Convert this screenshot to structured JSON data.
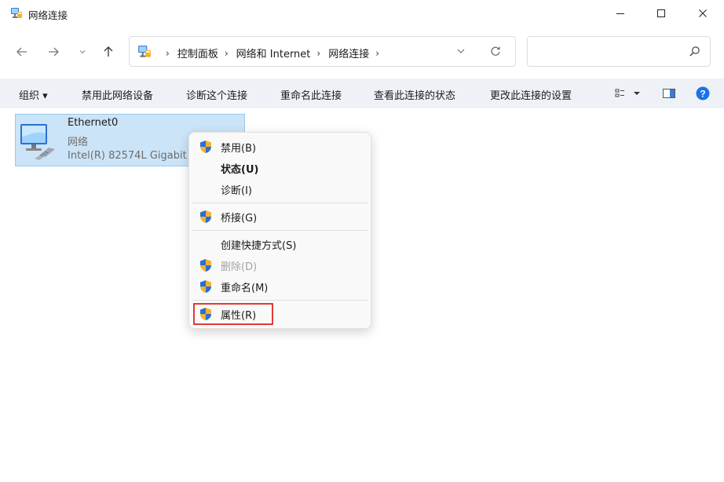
{
  "window": {
    "title": "网络连接",
    "minimize_label": "—",
    "maximize_label": "☐",
    "close_label": "✕"
  },
  "addressbar": {
    "crumbs": [
      "控制面板",
      "网络和 Internet",
      "网络连接"
    ]
  },
  "toolbar": {
    "organize": "组织 ▾",
    "disable_device": "禁用此网络设备",
    "diagnose": "诊断这个连接",
    "rename": "重命名此连接",
    "view_status": "查看此连接的状态",
    "change_settings": "更改此连接的设置"
  },
  "connection": {
    "name": "Ethernet0",
    "status": "网络",
    "device": "Intel(R) 82574L Gigabit"
  },
  "context_menu": {
    "items": [
      {
        "label": "禁用(B)",
        "shield": true
      },
      {
        "label": "状态(U)",
        "shield": false
      },
      {
        "label": "诊断(I)",
        "shield": false
      },
      {
        "label": "桥接(G)",
        "shield": true
      },
      {
        "label": "创建快捷方式(S)",
        "shield": false
      },
      {
        "label": "删除(D)",
        "shield": true,
        "disabled": true
      },
      {
        "label": "重命名(M)",
        "shield": true
      },
      {
        "label": "属性(R)",
        "shield": true,
        "highlighted": true
      }
    ]
  },
  "colors": {
    "accent": "#0067c0",
    "selection": "#cce4f7",
    "highlight_box": "#e53935",
    "help": "#1a73e8"
  }
}
